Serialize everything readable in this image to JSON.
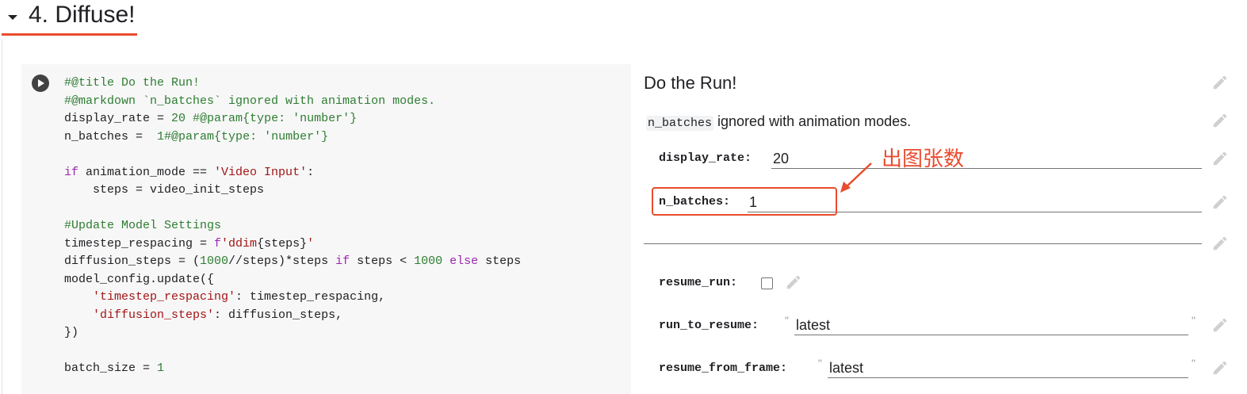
{
  "section": {
    "title": "4. Diffuse!"
  },
  "code_lines": [
    [
      {
        "t": "#@title Do the Run!",
        "c": "c"
      }
    ],
    [
      {
        "t": "#@markdown `n_batches` ignored with animation modes.",
        "c": "c"
      }
    ],
    [
      {
        "t": "display_rate = "
      },
      {
        "t": "20",
        "c": "n"
      },
      {
        "t": " #@param{type: 'number'}",
        "c": "c"
      }
    ],
    [
      {
        "t": "n_batches =  "
      },
      {
        "t": "1",
        "c": "n"
      },
      {
        "t": "#@param{type: 'number'}",
        "c": "c"
      }
    ],
    [],
    [
      {
        "t": "if",
        "c": "k"
      },
      {
        "t": " animation_mode == "
      },
      {
        "t": "'Video Input'",
        "c": "s"
      },
      {
        "t": ":"
      }
    ],
    [
      {
        "t": "    steps = video_init_steps"
      }
    ],
    [],
    [
      {
        "t": "#Update Model Settings",
        "c": "c"
      }
    ],
    [
      {
        "t": "timestep_respacing = "
      },
      {
        "t": "f",
        "c": "k"
      },
      {
        "t": "'ddim",
        "c": "s"
      },
      {
        "t": "{steps}"
      },
      {
        "t": "'",
        "c": "s"
      }
    ],
    [
      {
        "t": "diffusion_steps = ("
      },
      {
        "t": "1000",
        "c": "n"
      },
      {
        "t": "//steps)*steps "
      },
      {
        "t": "if",
        "c": "k"
      },
      {
        "t": " steps < "
      },
      {
        "t": "1000",
        "c": "n"
      },
      {
        "t": " "
      },
      {
        "t": "else",
        "c": "k"
      },
      {
        "t": " steps"
      }
    ],
    [
      {
        "t": "model_config.update({"
      }
    ],
    [
      {
        "t": "    "
      },
      {
        "t": "'timestep_respacing'",
        "c": "s"
      },
      {
        "t": ": timestep_respacing,"
      }
    ],
    [
      {
        "t": "    "
      },
      {
        "t": "'diffusion_steps'",
        "c": "s"
      },
      {
        "t": ": diffusion_steps,"
      }
    ],
    [
      {
        "t": "})"
      }
    ],
    [],
    [
      {
        "t": "batch_size = "
      },
      {
        "t": "1",
        "c": "n"
      }
    ]
  ],
  "form": {
    "title": "Do the Run!",
    "desc_code": "n_batches",
    "desc_text": " ignored with animation modes.",
    "display_rate_label": "display_rate:",
    "display_rate_value": "20",
    "n_batches_label": "n_batches:",
    "n_batches_value": "1",
    "resume_run_label": "resume_run:",
    "resume_run_checked": false,
    "run_to_resume_label": "run_to_resume:",
    "run_to_resume_value": "latest",
    "resume_from_frame_label": "resume_from_frame:",
    "resume_from_frame_value": "latest",
    "quote_open": "\"",
    "quote_close": "\""
  },
  "annotation": {
    "text": "出图张数"
  },
  "colors": {
    "accent": "#e94c2f",
    "comment": "#2e7d32",
    "keyword": "#9c27b0",
    "string": "#a31515"
  },
  "icons": {
    "collapse": "caret-down-icon",
    "run": "play-icon",
    "edit": "pencil-icon"
  }
}
